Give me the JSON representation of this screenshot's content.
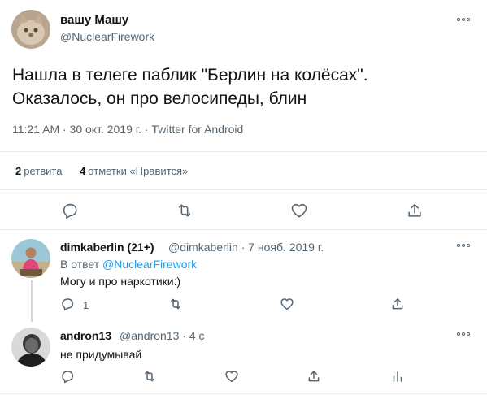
{
  "main_tweet": {
    "display_name": "вашу Машу",
    "handle": "@NuclearFirework",
    "text_line1": "Нашла в телеге паблик \"Берлин на колёсах\".",
    "text_line2": "Оказалось, он про велосипеды, блин",
    "timestamp": "11:21 AM · 30 окт. 2019 г. · Twitter for Android",
    "retweets_count": "2",
    "retweets_label": "ретвита",
    "likes_count": "4",
    "likes_label": "отметки «Нравится»"
  },
  "replies": [
    {
      "display_name": "dimkaberlin (21+)",
      "handle_date": "@dimkaberlin · 7 нояб. 2019 г.",
      "reply_to_prefix": "В ответ",
      "reply_to_handle": "@NuclearFirework",
      "text": "Могу и про наркотики:)",
      "reply_count": "1"
    },
    {
      "display_name": "andron13",
      "handle_date": "@andron13 · 4 с",
      "text": "не придумывай"
    }
  ],
  "icons": {
    "reply": "reply-icon",
    "retweet": "retweet-icon",
    "like": "heart-icon",
    "share": "share-icon",
    "analytics": "analytics-icon",
    "more": "more-icon"
  },
  "colors": {
    "text": "#0f1419",
    "secondary": "#536471",
    "link": "#1d9bf0",
    "divider": "#e6ecf0"
  }
}
